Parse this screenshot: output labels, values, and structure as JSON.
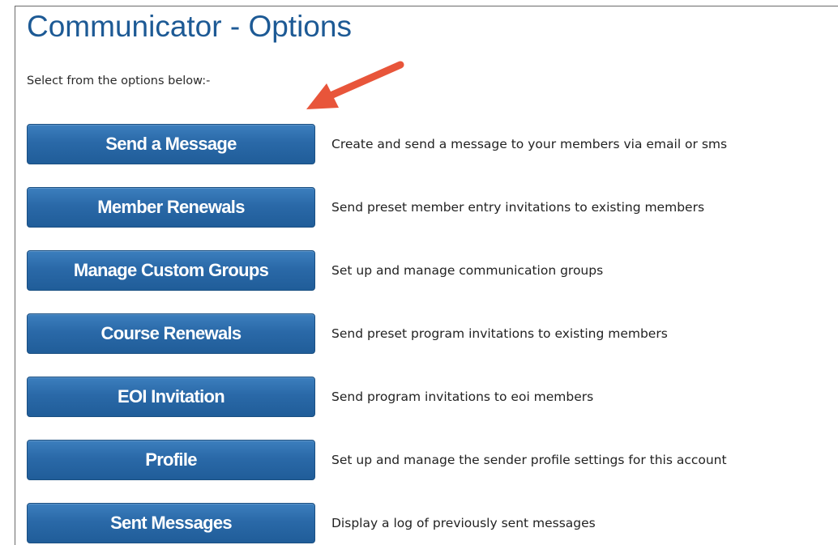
{
  "header": {
    "title": "Communicator - Options",
    "intro": "Select from the options below:-"
  },
  "annotation": {
    "arrow_color": "#e8553a",
    "icon": "arrow-icon"
  },
  "colors": {
    "title": "#1d5a95",
    "button_bg": "#2a69a8",
    "button_text": "#ffffff"
  },
  "options": [
    {
      "label": "Send a Message",
      "description": "Create and send a message to your members via email or sms"
    },
    {
      "label": "Member Renewals",
      "description": "Send preset member entry invitations to existing members"
    },
    {
      "label": "Manage Custom Groups",
      "description": "Set up and manage communication groups"
    },
    {
      "label": "Course Renewals",
      "description": "Send preset program invitations to existing members"
    },
    {
      "label": "EOI Invitation",
      "description": "Send program invitations to eoi members"
    },
    {
      "label": "Profile",
      "description": "Set up and manage the sender profile settings for this account"
    },
    {
      "label": "Sent Messages",
      "description": "Display a log of previously sent messages"
    }
  ]
}
